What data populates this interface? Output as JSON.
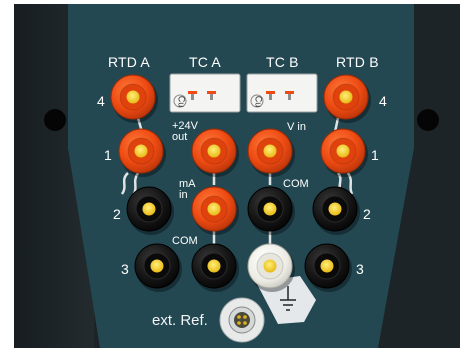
{
  "panel": {
    "headers": {
      "rtd_a": "RTD A",
      "tc_a": "TC A",
      "tc_b": "TC B",
      "rtd_b": "RTD B"
    },
    "left_numbers": [
      "4",
      "1",
      "2",
      "3"
    ],
    "right_numbers": [
      "4",
      "1",
      "2",
      "3"
    ],
    "labels": {
      "plus24v_out": "+24V\nout",
      "v_in": "V in",
      "ma_in": "mA\nin",
      "com_left": "COM",
      "com_right": "COM",
      "ext_ref": "ext. Ref."
    },
    "tc_glyph": "Cu",
    "colors": {
      "background_dark": "#1c2327",
      "panel_teal": "#234750",
      "terminal_red": "#ee4a12",
      "terminal_black": "#141414",
      "terminal_white": "#f2f2ea",
      "terminal_center": "#f2c51a"
    }
  }
}
